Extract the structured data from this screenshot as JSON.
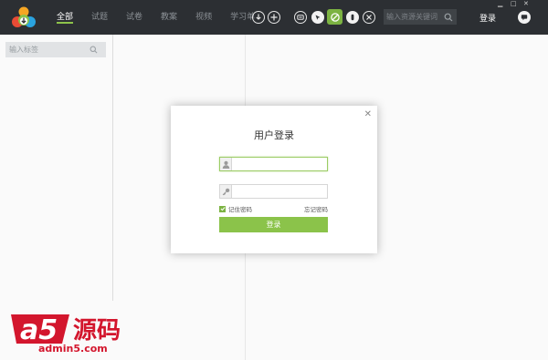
{
  "nav": {
    "tabs": [
      {
        "label": "全部",
        "active": true
      },
      {
        "label": "试题"
      },
      {
        "label": "试卷"
      },
      {
        "label": "教案"
      },
      {
        "label": "视频"
      },
      {
        "label": "学习单"
      }
    ]
  },
  "toolbar": {
    "search_placeholder": "输入资源关键词",
    "login_label": "登录"
  },
  "sidebar": {
    "tag_placeholder": "输入标签"
  },
  "dialog": {
    "title": "用户登录",
    "remember_label": "记住密码",
    "forgot_label": "忘记密码",
    "submit_label": "登录"
  },
  "watermark": {
    "brand": "a5源码",
    "url": "admin5.com"
  },
  "colors": {
    "topbar": "#2c2f33",
    "accent": "#8bc34a"
  }
}
